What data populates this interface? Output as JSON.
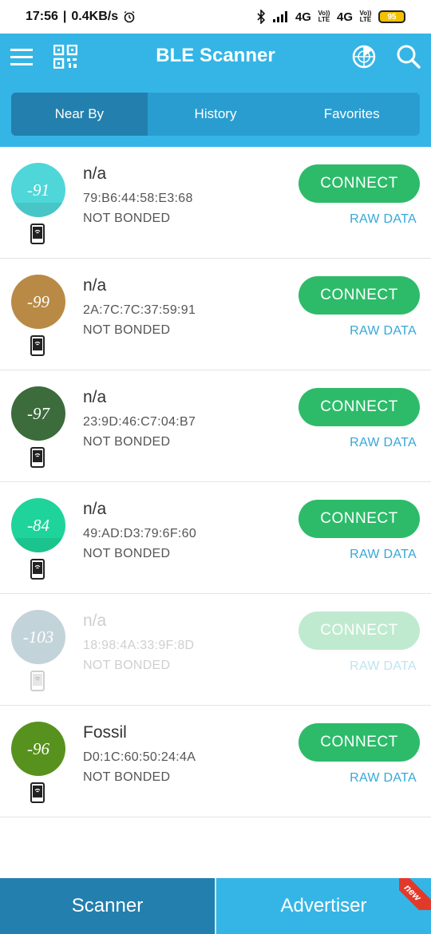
{
  "statusbar": {
    "time": "17:56",
    "speed": "0.4KB/s",
    "network1": "4G",
    "network2": "4G",
    "volte1": "Vo)) LTE",
    "volte2": "Vo)) LTE",
    "battery": "95"
  },
  "appbar": {
    "title": "BLE Scanner"
  },
  "tabs": [
    {
      "label": "Near By",
      "active": true
    },
    {
      "label": "History",
      "active": false
    },
    {
      "label": "Favorites",
      "active": false
    }
  ],
  "devices": [
    {
      "rssi": "-91",
      "name": "n/a",
      "mac": "79:B6:44:58:E3:68",
      "bond": "NOT BONDED",
      "connect": "CONNECT",
      "raw": "RAW DATA",
      "color": "#4fd6d8"
    },
    {
      "rssi": "-99",
      "name": "n/a",
      "mac": "2A:7C:7C:37:59:91",
      "bond": "NOT BONDED",
      "connect": "CONNECT",
      "raw": "RAW DATA",
      "color": "#b98a45"
    },
    {
      "rssi": "-97",
      "name": "n/a",
      "mac": "23:9D:46:C7:04:B7",
      "bond": "NOT BONDED",
      "connect": "CONNECT",
      "raw": "RAW DATA",
      "color": "#3c6b3c"
    },
    {
      "rssi": "-84",
      "name": "n/a",
      "mac": "49:AD:D3:79:6F:60",
      "bond": "NOT BONDED",
      "connect": "CONNECT",
      "raw": "RAW DATA",
      "color": "#1ed49a"
    },
    {
      "rssi": "-103",
      "name": "n/a",
      "mac": "18:98:4A:33:9F:8D",
      "bond": "NOT BONDED",
      "connect": "CONNECT",
      "raw": "RAW DATA",
      "color": "#c3d3da"
    },
    {
      "rssi": "-96",
      "name": "Fossil",
      "mac": "D0:1C:60:50:24:4A",
      "bond": "NOT BONDED",
      "connect": "CONNECT",
      "raw": "RAW DATA",
      "color": "#57921e"
    }
  ],
  "bottom_nav": {
    "scanner": "Scanner",
    "advertiser": "Advertiser",
    "badge": "new"
  }
}
